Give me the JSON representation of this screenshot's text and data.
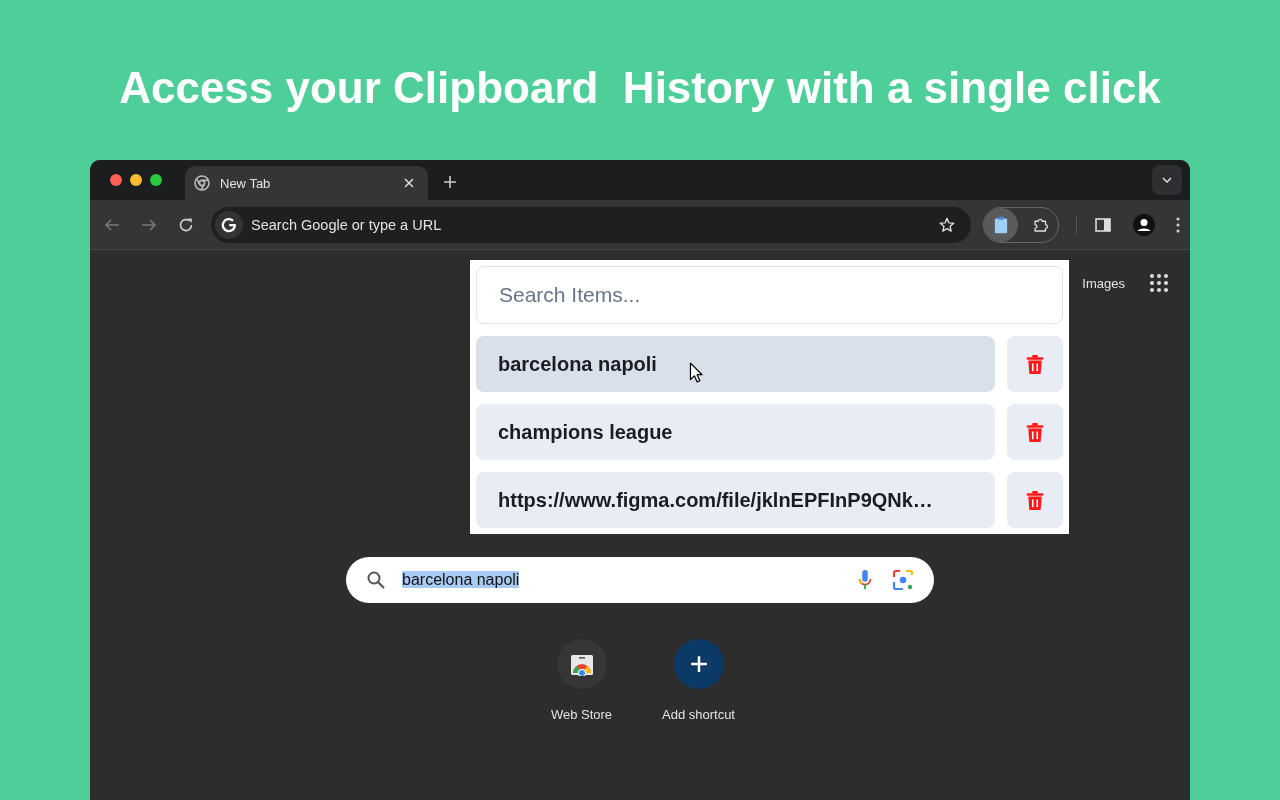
{
  "headline": "Access your Clipboard  History with a single click",
  "browser": {
    "tab": {
      "title": "New Tab",
      "selected": true
    },
    "address_bar": {
      "placeholder": "Search Google or type a URL"
    },
    "clipboard_extension": {
      "selected": true
    }
  },
  "new_tab_page": {
    "top_links": [
      "Images"
    ],
    "search": {
      "value": "barcelona napoli",
      "text_selected": true
    },
    "shortcuts": [
      {
        "kind": "store",
        "label": "Web Store"
      },
      {
        "kind": "add",
        "label": "Add shortcut"
      }
    ]
  },
  "clipboard_popup": {
    "search": {
      "placeholder": "Search Items..."
    },
    "items": [
      {
        "text": "barcelona napoli",
        "hovered": true
      },
      {
        "text": "champions league",
        "hovered": false
      },
      {
        "text": "https://www.figma.com/file/jklnEPFInP9QNk…",
        "hovered": false
      }
    ]
  }
}
